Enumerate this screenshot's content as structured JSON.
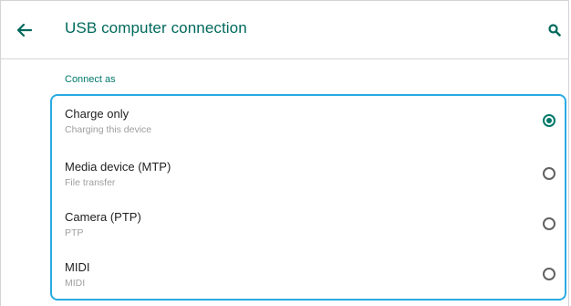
{
  "appbar": {
    "title": "USB computer connection",
    "back_icon": "arrow-left-icon",
    "search_icon": "search-icon"
  },
  "section": {
    "header": "Connect as"
  },
  "options": [
    {
      "label": "Charge only",
      "sub": "Charging this device",
      "selected": true
    },
    {
      "label": "Media device (MTP)",
      "sub": "File transfer",
      "selected": false
    },
    {
      "label": "Camera (PTP)",
      "sub": "PTP",
      "selected": false
    },
    {
      "label": "MIDI",
      "sub": "MIDI",
      "selected": false
    }
  ],
  "colors": {
    "accent": "#00796b",
    "title": "#00695c",
    "focus": "#29abe2"
  }
}
